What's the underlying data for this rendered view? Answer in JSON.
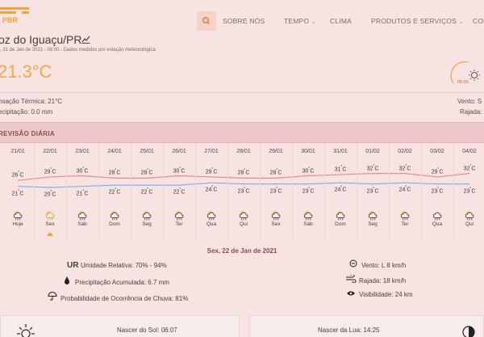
{
  "logo": {
    "text": "PBR"
  },
  "nav": {
    "about": "SOBRE NÓS",
    "weather": "TEMPO",
    "climate": "CLIMA",
    "products": "PRODUTOS E SERVIÇOS",
    "more": "CONS"
  },
  "location": {
    "city": "oz do Iguaçu/PR",
    "meta": ", 21 de Jan de 2021 - 08:00 - Dados medidos por estação meteorológica",
    "temperature": "21.3°C",
    "sunrise_time": "06:06"
  },
  "current": {
    "feels_like": "nsação Térmica: 21°C",
    "precipitation": "ecipitação: 0.0 mm",
    "wind": "Vento: S",
    "gust": "Rajada: "
  },
  "forecast": {
    "title": "REVISÃO DIÁRIA",
    "days": [
      {
        "date": "21/01",
        "max": "26",
        "min": "21",
        "name": "Hoje",
        "icon": "sun-cloud-rain-icon"
      },
      {
        "date": "22/01",
        "max": "29",
        "min": "20",
        "name": "Sex",
        "icon": "sun-rain-icon"
      },
      {
        "date": "23/01",
        "max": "30",
        "min": "21",
        "name": "Sáb",
        "icon": "sun-cloud-rain-icon"
      },
      {
        "date": "24/01",
        "max": "28",
        "min": "22",
        "name": "Dom",
        "icon": "sun-cloud-rain-icon"
      },
      {
        "date": "25/01",
        "max": "28",
        "min": "22",
        "name": "Seg",
        "icon": "sun-cloud-rain-icon"
      },
      {
        "date": "26/01",
        "max": "30",
        "min": "22",
        "name": "Ter",
        "icon": "sun-cloud-rain-icon"
      },
      {
        "date": "27/01",
        "max": "29",
        "min": "24",
        "name": "Qua",
        "icon": "sun-cloud-rain-icon"
      },
      {
        "date": "28/01",
        "max": "28",
        "min": "23",
        "name": "Qui",
        "icon": "sun-cloud-rain-icon"
      },
      {
        "date": "29/01",
        "max": "28",
        "min": "23",
        "name": "Sex",
        "icon": "sun-cloud-rain-icon"
      },
      {
        "date": "30/01",
        "max": "30",
        "min": "23",
        "name": "Sáb",
        "icon": "sun-cloud-rain-icon"
      },
      {
        "date": "31/01",
        "max": "31",
        "min": "24",
        "name": "Dom",
        "icon": "sun-cloud-rain-icon"
      },
      {
        "date": "01/02",
        "max": "32",
        "min": "23",
        "name": "Seg",
        "icon": "sun-cloud-rain-icon"
      },
      {
        "date": "02/02",
        "max": "32",
        "min": "24",
        "name": "Ter",
        "icon": "sun-cloud-rain-icon"
      },
      {
        "date": "03/02",
        "max": "29",
        "min": "23",
        "name": "Qua",
        "icon": "cloud-rain-icon"
      },
      {
        "date": "04/02",
        "max": "32",
        "min": "23",
        "name": "Qui",
        "icon": "sun-cloud-rain-icon"
      }
    ]
  },
  "selected_day": {
    "date": "Sex, 22 de Jan de 2021",
    "uv_label": "UR",
    "humidity": "Umidade Relativa: 70% - 94%",
    "precip": "Precipitação Acumulada: 6.7 mm",
    "rain_prob": "Probabilidade de Ocorrência de Chuva: 81%",
    "wind": "Vento: L 8 km/h",
    "gust": "Rajada: 18 km/h",
    "visibility": "Visibilidade: 24 km"
  },
  "sun_moon": {
    "sunrise": "Nascer do Sol: 06:07",
    "moonrise": "Nascer da Lua: 14:25"
  },
  "colors": {
    "accent": "#f5a64a",
    "max_line": "#e98b8b",
    "min_line": "#7fb3e8"
  }
}
